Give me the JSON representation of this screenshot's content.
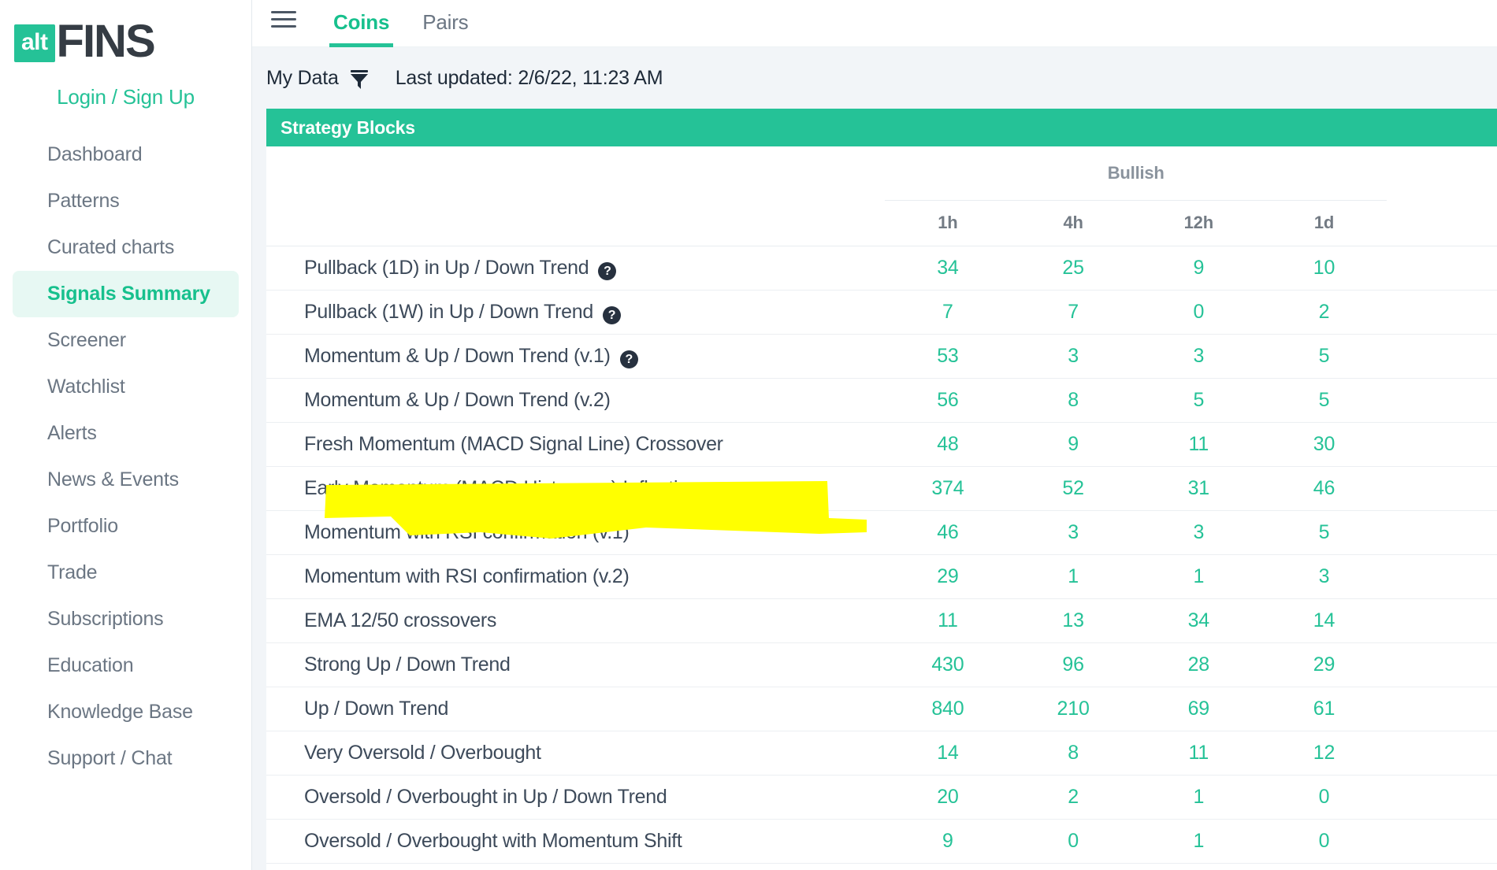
{
  "brand": {
    "logo_badge": "alt",
    "logo_text": "FINS",
    "login_label": "Login / Sign Up"
  },
  "colors": {
    "accent": "#25c297",
    "accent_text": "#17c08d",
    "sidebar_active_bg": "#e7f8f3",
    "nav_text": "#6b7683",
    "value_text": "#25c297",
    "highlight": "#ffff00",
    "header_grey": "#8a939d",
    "page_bg": "#f2f5f8"
  },
  "sidebar": {
    "items": [
      {
        "label": "Dashboard",
        "active": false
      },
      {
        "label": "Patterns",
        "active": false
      },
      {
        "label": "Curated charts",
        "active": false
      },
      {
        "label": "Signals Summary",
        "active": true
      },
      {
        "label": "Screener",
        "active": false
      },
      {
        "label": "Watchlist",
        "active": false
      },
      {
        "label": "Alerts",
        "active": false
      },
      {
        "label": "News & Events",
        "active": false
      },
      {
        "label": "Portfolio",
        "active": false
      },
      {
        "label": "Trade",
        "active": false
      },
      {
        "label": "Subscriptions",
        "active": false
      },
      {
        "label": "Education",
        "active": false
      },
      {
        "label": "Knowledge Base",
        "active": false
      },
      {
        "label": "Support / Chat",
        "active": false
      }
    ]
  },
  "topbar": {
    "menu_icon": "hamburger-icon",
    "tabs": [
      {
        "label": "Coins",
        "active": true
      },
      {
        "label": "Pairs",
        "active": false
      }
    ]
  },
  "filterbar": {
    "my_data_label": "My Data",
    "filter_icon": "funnel-icon",
    "last_updated": "Last updated: 2/6/22, 11:23 AM"
  },
  "table": {
    "card_title": "Strategy Blocks",
    "group_header": "Bullish",
    "columns": [
      "1h",
      "4h",
      "12h",
      "1d"
    ],
    "help_icon_glyph": "?",
    "rows": [
      {
        "name": "Pullback (1D) in Up / Down Trend",
        "help": true,
        "highlighted": false,
        "values": [
          "34",
          "25",
          "9",
          "10"
        ]
      },
      {
        "name": "Pullback (1W) in Up / Down Trend",
        "help": true,
        "highlighted": false,
        "values": [
          "7",
          "7",
          "0",
          "2"
        ]
      },
      {
        "name": "Momentum & Up / Down Trend (v.1)",
        "help": true,
        "highlighted": false,
        "values": [
          "53",
          "3",
          "3",
          "5"
        ]
      },
      {
        "name": "Momentum & Up / Down Trend (v.2)",
        "help": false,
        "highlighted": false,
        "values": [
          "56",
          "8",
          "5",
          "5"
        ]
      },
      {
        "name": "Fresh Momentum (MACD Signal Line) Crossover",
        "help": false,
        "highlighted": false,
        "values": [
          "48",
          "9",
          "11",
          "30"
        ]
      },
      {
        "name": "Early Momentum (MACD Histogram) Inflection",
        "help": false,
        "highlighted": true,
        "values": [
          "374",
          "52",
          "31",
          "46"
        ]
      },
      {
        "name": "Momentum with RSI confirmation (v.1)",
        "help": false,
        "highlighted": false,
        "values": [
          "46",
          "3",
          "3",
          "5"
        ]
      },
      {
        "name": "Momentum with RSI confirmation (v.2)",
        "help": false,
        "highlighted": false,
        "values": [
          "29",
          "1",
          "1",
          "3"
        ]
      },
      {
        "name": "EMA 12/50 crossovers",
        "help": false,
        "highlighted": false,
        "values": [
          "11",
          "13",
          "34",
          "14"
        ]
      },
      {
        "name": "Strong Up / Down Trend",
        "help": false,
        "highlighted": false,
        "values": [
          "430",
          "96",
          "28",
          "29"
        ]
      },
      {
        "name": "Up / Down Trend",
        "help": false,
        "highlighted": false,
        "values": [
          "840",
          "210",
          "69",
          "61"
        ]
      },
      {
        "name": "Very Oversold / Overbought",
        "help": false,
        "highlighted": false,
        "values": [
          "14",
          "8",
          "11",
          "12"
        ]
      },
      {
        "name": "Oversold / Overbought in Up / Down Trend",
        "help": false,
        "highlighted": false,
        "values": [
          "20",
          "2",
          "1",
          "0"
        ]
      },
      {
        "name": "Oversold / Overbought with Momentum Shift",
        "help": false,
        "highlighted": false,
        "values": [
          "9",
          "0",
          "1",
          "0"
        ]
      }
    ]
  }
}
